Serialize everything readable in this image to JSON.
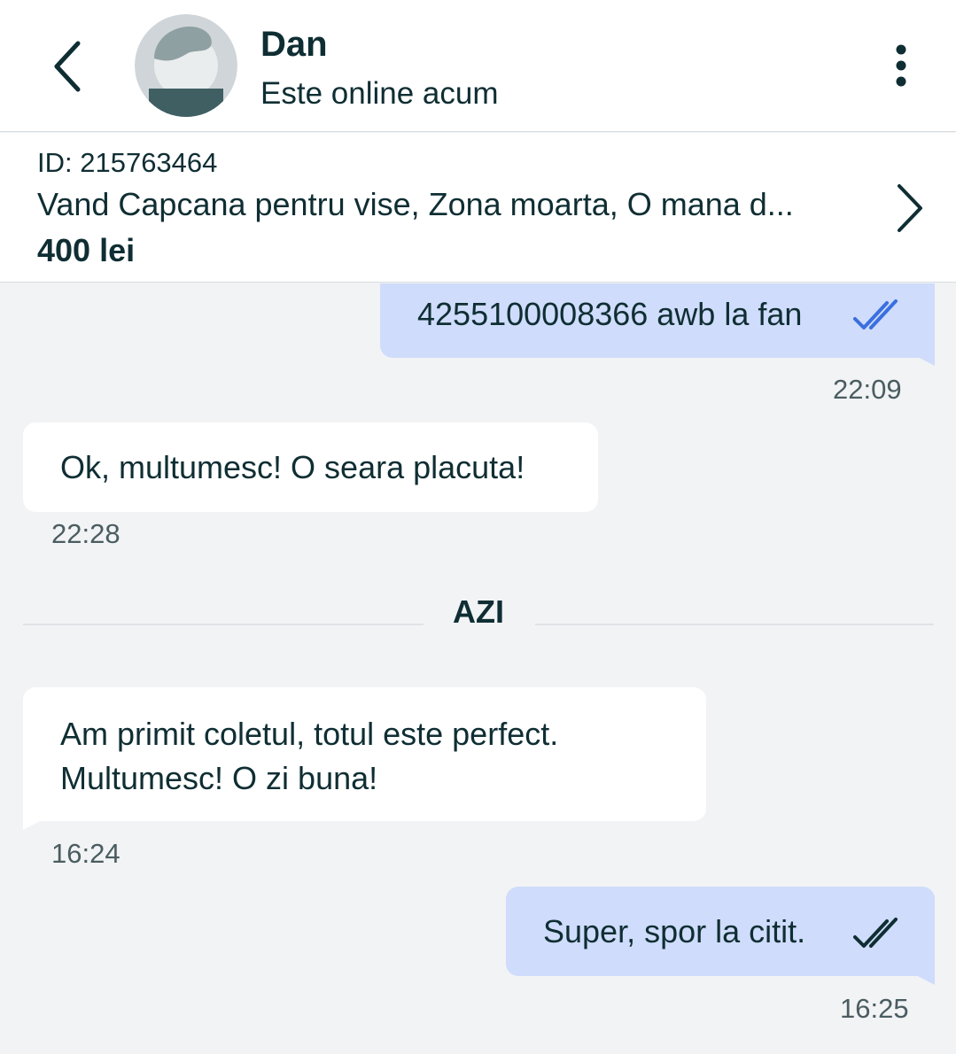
{
  "header": {
    "contact_name": "Dan",
    "status": "Este online acum",
    "icons": {
      "back": "back-arrow-icon",
      "menu": "more-vertical-icon",
      "avatar": "default-avatar-icon"
    }
  },
  "listing": {
    "id_text": "ID: 215763464",
    "title": "Vand Capcana pentru vise, Zona moarta, O mana d...",
    "price": "400 lei",
    "icon": "chevron-right-icon"
  },
  "messages_earlier": [
    {
      "direction": "outgoing",
      "text": "4255100008366 awb la fan",
      "time": "22:09",
      "status": "read"
    },
    {
      "direction": "incoming",
      "text": "Ok, multumesc! O seara placuta!",
      "time": "22:28"
    }
  ],
  "day_separator": "AZI",
  "messages_today": [
    {
      "direction": "incoming",
      "lines": [
        "Am primit coletul, totul este perfect.",
        "Multumesc! O zi buna!"
      ],
      "time": "16:24"
    },
    {
      "direction": "outgoing",
      "text": "Super, spor la citit.",
      "time": "16:25",
      "status": "delivered"
    }
  ],
  "colors": {
    "background": "#f2f3f5",
    "outgoing_bubble": "#cfdcfb",
    "incoming_bubble": "#ffffff",
    "text": "#0f2e33",
    "read_tick": "#3a6fe0",
    "delivered_tick": "#0f2e33"
  }
}
